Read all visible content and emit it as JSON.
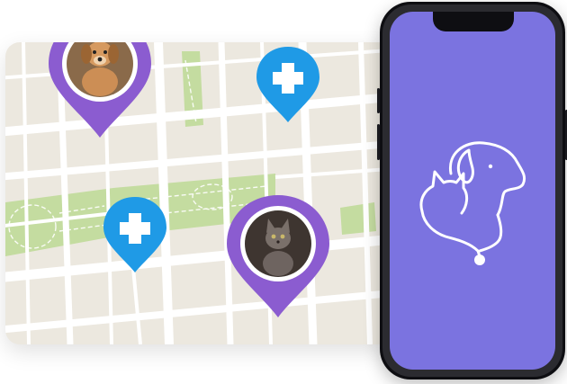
{
  "colors": {
    "map_background": "#ece8df",
    "road": "#ffffff",
    "park": "#c4dca0",
    "pet_pin": "#8b5cd0",
    "vet_pin": "#1f9ae6",
    "phone_screen": "#7b73e0",
    "logo_stroke": "#ffffff"
  },
  "map": {
    "pins": [
      {
        "type": "pet",
        "animal": "puppy",
        "icon": "dog-photo-icon"
      },
      {
        "type": "vet",
        "icon": "medical-cross-icon"
      },
      {
        "type": "vet",
        "icon": "medical-cross-icon"
      },
      {
        "type": "pet",
        "animal": "kitten",
        "icon": "cat-photo-icon"
      }
    ]
  },
  "phone": {
    "screen_icon": "pet-care-logo-icon"
  }
}
